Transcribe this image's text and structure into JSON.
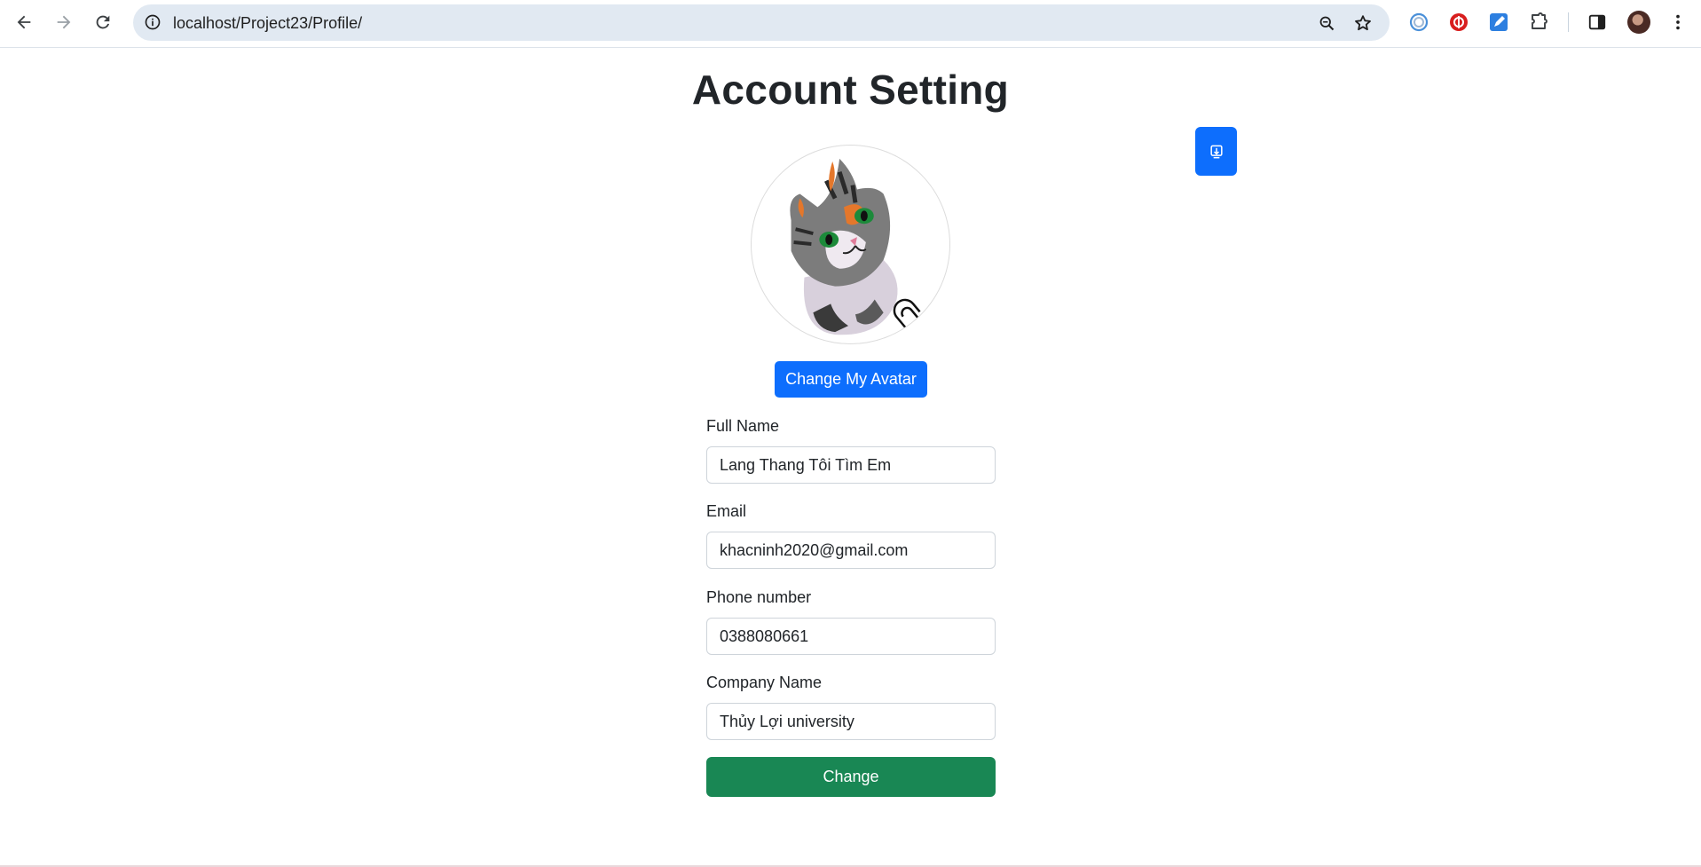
{
  "browser": {
    "url": "localhost/Project23/Profile/"
  },
  "page": {
    "title": "Account Setting",
    "change_avatar_label": "Change My Avatar",
    "submit_label": "Change"
  },
  "form": {
    "fields": [
      {
        "label": "Full Name",
        "value": "Lang Thang Tôi Tìm Em"
      },
      {
        "label": "Email",
        "value": "khacninh2020@gmail.com"
      },
      {
        "label": "Phone number",
        "value": "0388080661"
      },
      {
        "label": "Company Name",
        "value": "Thủy Lợi university"
      }
    ]
  },
  "colors": {
    "primary": "#0d6efd",
    "success": "#198754",
    "omnibox": "#e1e9f2"
  },
  "icons": [
    "back-arrow-icon",
    "forward-arrow-icon",
    "reload-icon",
    "site-info-icon",
    "zoom-icon",
    "bookmark-star-icon",
    "extension-icon",
    "side-panel-icon",
    "more-menu-icon",
    "download-icon"
  ]
}
